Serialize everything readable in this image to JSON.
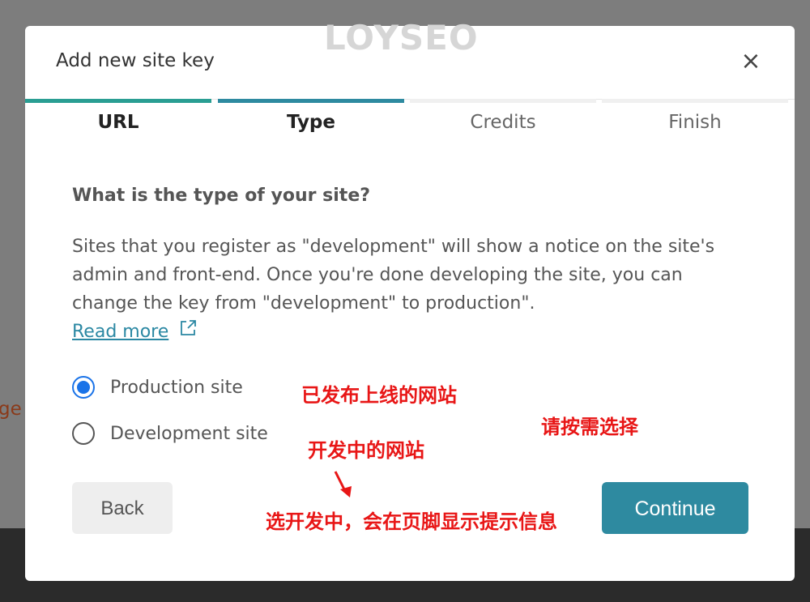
{
  "background": {
    "partial_text": "ge"
  },
  "watermark": {
    "text": "LOYSEO"
  },
  "modal": {
    "title": "Add new site key",
    "close_icon": "×",
    "steps": [
      {
        "label": "URL",
        "state": "done"
      },
      {
        "label": "Type",
        "state": "active"
      },
      {
        "label": "Credits",
        "state": "pending"
      },
      {
        "label": "Finish",
        "state": "pending"
      }
    ],
    "question": "What is the type of your site?",
    "description": "Sites that you register as \"development\" will show a notice on the site's admin and front-end. Once you're done developing the site, you can change the key from \"development\" to production\".",
    "read_more": "Read more",
    "options": [
      {
        "label": "Production site",
        "selected": true
      },
      {
        "label": "Development site",
        "selected": false
      }
    ],
    "back_label": "Back",
    "continue_label": "Continue"
  },
  "annotations": {
    "production": "已发布上线的网站",
    "choose": "请按需选择",
    "development": "开发中的网站",
    "footer_note": "选开发中，会在页脚显示提示信息"
  },
  "colors": {
    "accent": "#2e8aa0",
    "step_done": "#2a9e93",
    "radio_checked": "#1a73e8",
    "annotation": "#e81616"
  }
}
